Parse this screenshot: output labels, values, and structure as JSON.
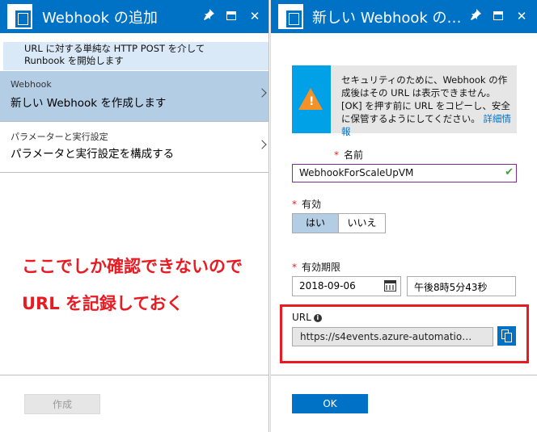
{
  "left_blade": {
    "title": "Webhook の追加",
    "pin_icon": "pin-icon",
    "maximize_icon": "maximize-icon",
    "close_icon": "close-icon",
    "close_glyph": "✕",
    "pin_glyph": "📌",
    "info_line1": "URL に対する単純な HTTP POST を介して",
    "info_line2": "Runbook を開始します",
    "items": [
      {
        "small": "Webhook",
        "main": "新しい Webhook を作成します"
      },
      {
        "small": "パラメーターと実行設定",
        "main": "パラメータと実行設定を構成する"
      }
    ],
    "annotation_line1": "ここでしか確認できないので",
    "annotation_line2": "URL を記録しておく",
    "create_label": "作成"
  },
  "right_blade": {
    "title": "新しい Webhook の…",
    "warning_text": "セキュリティのために、Webhook の作成後はその URL は表示できません。[OK] を押す前に URL をコピーし、安全に保管するようにしてください。",
    "warning_link": "詳細情報",
    "name_label": "名前",
    "name_value": "WebhookForScaleUpVM",
    "enabled_label": "有効",
    "yes_label": "はい",
    "no_label": "いいえ",
    "expiry_label": "有効期限",
    "expiry_date": "2018-09-06",
    "expiry_time": "午後8時5分43秒",
    "url_label": "URL",
    "url_value": "https://s4events.azure-automatio…",
    "ok_label": "OK"
  },
  "colors": {
    "titlebar": "#0072c6",
    "selected_item": "#b3cde5",
    "annotation_red": "#e81b23",
    "warning_orange": "#f69128",
    "warning_blue": "#00a1e6"
  }
}
